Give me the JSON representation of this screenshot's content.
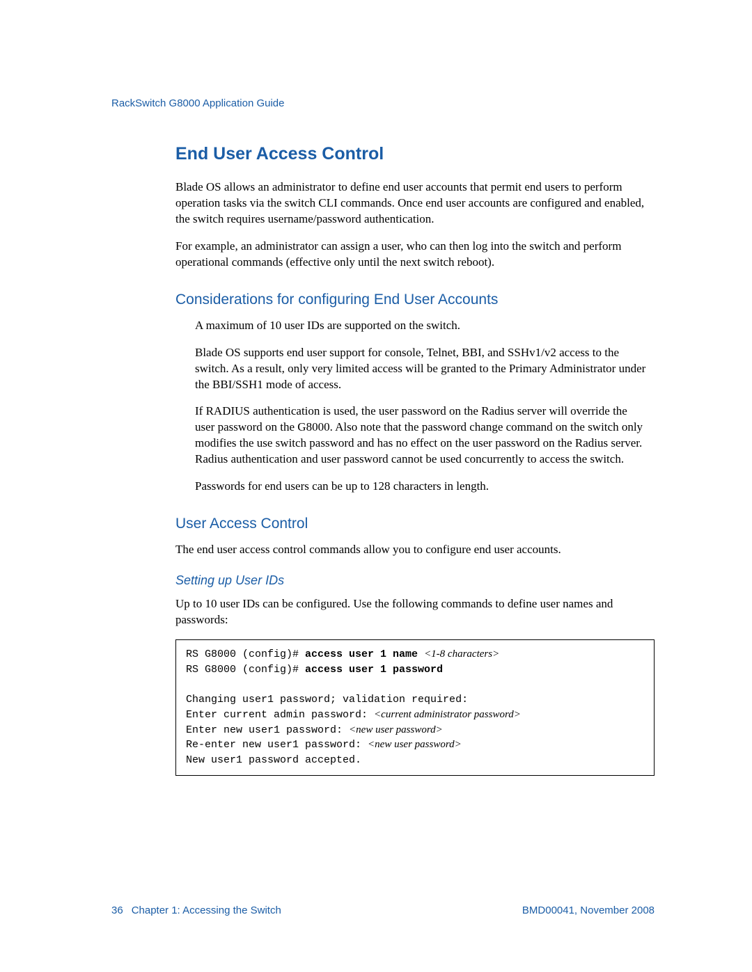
{
  "header": {
    "title": "RackSwitch G8000  Application Guide"
  },
  "sections": {
    "h1": "End User Access Control",
    "p1": "Blade OS allows an administrator to define end user accounts that permit end users to perform operation tasks via the switch CLI commands. Once end user accounts are configured and enabled, the switch requires username/password authentication.",
    "p2": " For example, an administrator can assign a user, who can then log into the switch and perform operational commands (effective only until the next switch reboot).",
    "h2a": "Considerations for configuring End User Accounts",
    "bul1": "A maximum of 10 user IDs are supported on the switch.",
    "bul2": "Blade OS supports end user support for console, Telnet, BBI, and SSHv1/v2 access to the switch. As a result, only very limited access will be granted to the Primary Administrator under the BBI/SSH1 mode of access.",
    "bul3": "If RADIUS authentication is used, the user password on the Radius server will override the user password on the G8000. Also note that the password change command on the switch only modifies the use switch password and has no effect on the user password on the Radius server. Radius authentication and user password cannot be used concurrently to access the switch.",
    "bul4": "Passwords for end users can be up to 128 characters in length.",
    "h2b": "User Access Control",
    "p3": "The end user access control commands allow you to configure end user accounts.",
    "h3a": "Setting up User IDs",
    "p4": "Up to 10 user IDs can be configured. Use the following commands to define user names and passwords:"
  },
  "code": {
    "l1_prompt": "RS G8000 (config)# ",
    "l1_cmd": "access user 1 name ",
    "l1_arg": "<1-8 characters>",
    "l2_prompt": "RS G8000 (config)# ",
    "l2_cmd": "access user 1 password",
    "l3": "Changing user1 password; validation required:",
    "l4a": "Enter current admin password: ",
    "l4b": "<current administrator password>",
    "l5a": "Enter new user1 password: ",
    "l5b": "<new user password>",
    "l6a": "Re-enter new user1 password: ",
    "l6b": "<new user password>",
    "l7": "New user1 password accepted."
  },
  "footer": {
    "pagenum": "36",
    "chapter": "Chapter 1:  Accessing the Switch",
    "docid": "BMD00041, November 2008"
  }
}
